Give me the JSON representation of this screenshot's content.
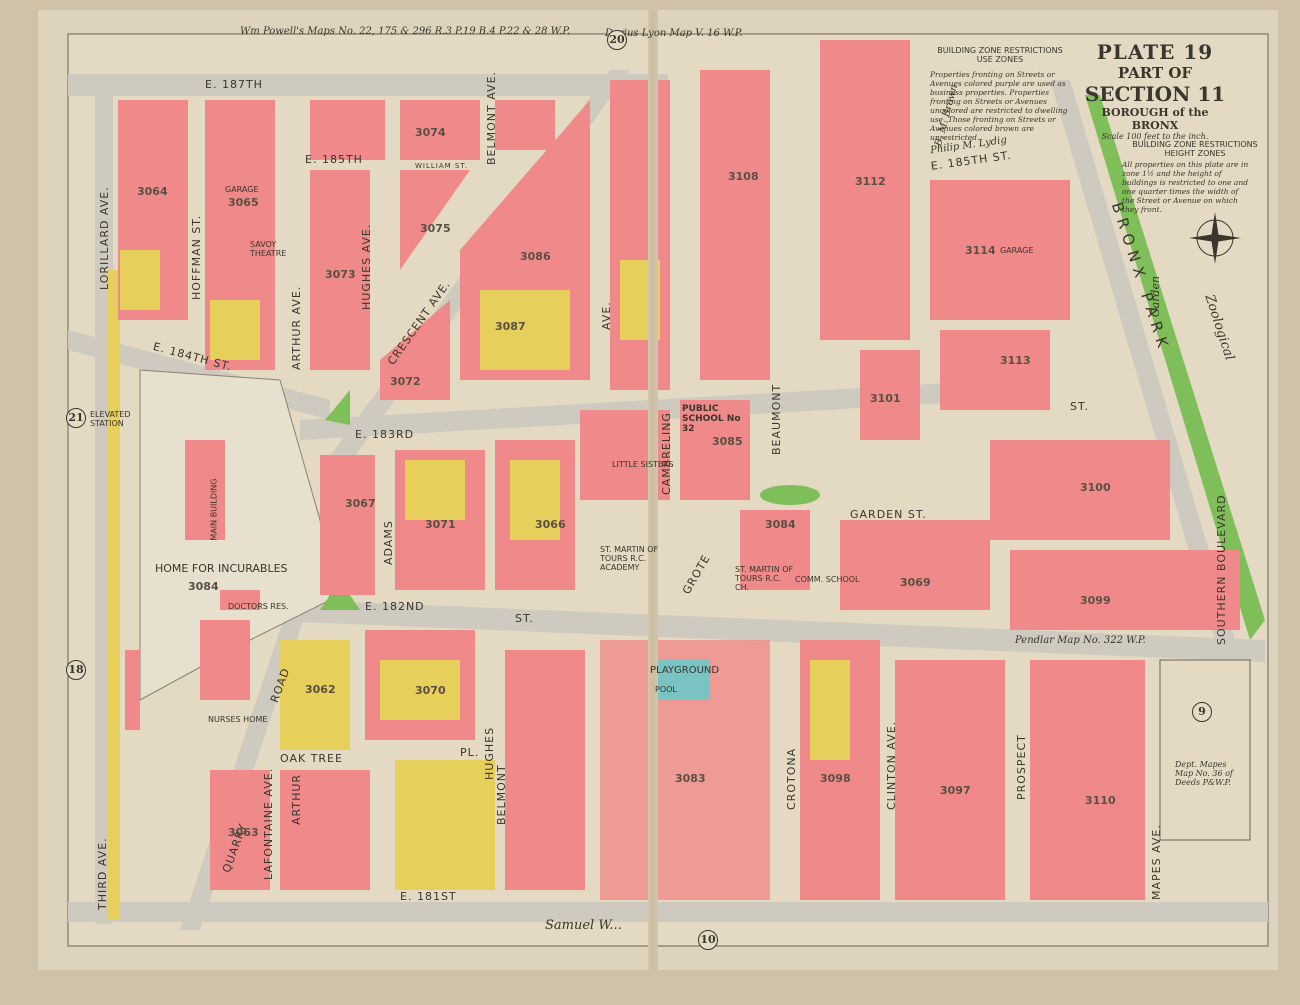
{
  "title": {
    "plate": "PLATE 19",
    "part_of": "PART OF",
    "section": "SECTION 11",
    "borough": "BOROUGH of the BRONX",
    "scale": "Scale 100 feet to the inch."
  },
  "legend": {
    "use_heading": "BUILDING ZONE RESTRICTIONS",
    "use_sub": "USE ZONES",
    "use_text": "Properties fronting on Streets or Avenues colored purple are used as business properties. Properties fronting on Streets or Avenues uncolored are restricted to dwelling use. Those fronting on Streets or Avenues colored brown are unrestricted.",
    "height_heading": "BUILDING ZONE RESTRICTIONS",
    "height_sub": "HEIGHT ZONES",
    "height_text": "All properties on this plate are in zone 1½ and the height of buildings is restricted to one and one quarter times the width of the Street or Avenue on which they front."
  },
  "margin_notes": {
    "top": "Wm Powell's Maps No. 22, 175 & 296 R.3 P.19 B.4 P.22 & 28 W.P.",
    "top_right": "Darius Lyon Map V. 16 W.P.",
    "bottom": "Samuel W...",
    "pendlar": "Pendlar Map No. 322 W.P.",
    "mapes": "Dept. Mapes Map No. 36 of Deeds P&W.P.",
    "brown": "B. M. Brown",
    "lydig": "Philip M. Lydig"
  },
  "adjacent_plates": [
    "21",
    "20",
    "18",
    "10",
    "9"
  ],
  "streets": {
    "e187": "E. 187TH",
    "e185": "E. 185TH",
    "e185r": "E. 185TH ST.",
    "e184": "E. 184TH ST.",
    "e183": "E. 183RD",
    "e182": "E. 182ND",
    "e182st": "ST.",
    "e181": "E. 181ST",
    "lorillard": "LORILLARD AVE.",
    "hoffman": "HOFFMAN ST.",
    "arthur": "ARTHUR AVE.",
    "hughes": "HUGHES AVE.",
    "belmont": "BELMONT AVE.",
    "crescent": "CRESCENT AVE.",
    "adams": "ADAMS",
    "quarry": "QUARRY",
    "road": "ROAD",
    "lafontaine": "LAFONTAINE AVE.",
    "oaktree": "OAK TREE",
    "pl": "PL.",
    "third": "THIRD AVE.",
    "grote": "GROTE",
    "cambreling": "CAMBRELING",
    "beaumont": "BEAUMONT",
    "crotona": "CROTONA",
    "clinton": "CLINTON AVE.",
    "prospect": "PROSPECT",
    "mapes": "MAPES AVE.",
    "southern": "SOUTHERN BOULEVARD",
    "bronx_park": "BRONX PARK",
    "zoological": "Zoological",
    "garden": "Garden",
    "garden_st": "GARDEN ST.",
    "st": "ST.",
    "william": "WILLIAM ST.",
    "arthur2": "ARTHUR",
    "belmont2": "BELMONT",
    "hughes2": "HUGHES",
    "ave": "AVE."
  },
  "blocks": [
    "3064",
    "3065",
    "3073",
    "3074",
    "3075",
    "3087",
    "3086",
    "3108",
    "3112",
    "3114",
    "3113",
    "3101",
    "3100",
    "3099",
    "3085",
    "3084",
    "3071",
    "3066",
    "3069",
    "3070",
    "3062",
    "3083",
    "3098",
    "3097",
    "3110",
    "3063",
    "3067",
    "3072"
  ],
  "landmarks": {
    "home": "HOME FOR INCURABLES",
    "home_block": "3084",
    "main_building": "MAIN BUILDING",
    "elevated": "ELEVATED STATION",
    "doctors": "DOCTORS RES.",
    "nurses": "NURSES HOME",
    "school": "PUBLIC SCHOOL No 32",
    "playground": "PLAYGROUND",
    "pool": "POOL",
    "academy": "ST. MARTIN OF TOURS R.C. ACADEMY",
    "church": "ST. MARTIN OF TOURS R.C. CH.",
    "little_sisters": "LITTLE SISTERS",
    "garage": "GARAGE",
    "savoy": "SAVOY THEATRE",
    "comm_school": "COMM. SCHOOL"
  },
  "colors": {
    "brick": "#f08a8a",
    "frame": "#e6cf5a",
    "park": "#7fbf5a",
    "paper": "#e4dac4",
    "street": "#cbc6ba"
  }
}
